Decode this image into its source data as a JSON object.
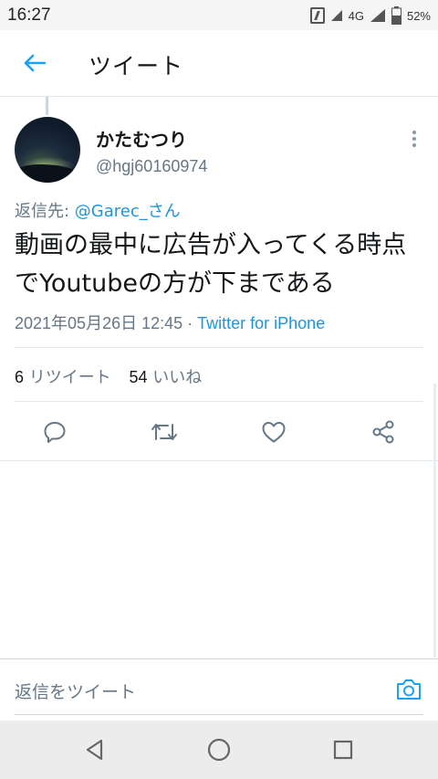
{
  "status_bar": {
    "time": "16:27",
    "network": "4G",
    "battery": "52%"
  },
  "header": {
    "title": "ツイート"
  },
  "tweet": {
    "display_name": "かたむつり",
    "handle": "@hgj60160974",
    "reply_prefix": "返信先: ",
    "reply_to": "@Garec_さん",
    "text": "動画の最中に広告が入ってくる時点でYoutubeの方が下まである",
    "timestamp": "2021年05月26日 12:45",
    "separator": " · ",
    "via": "Twitter for iPhone",
    "retweet_count": "6",
    "retweet_label": " リツイート",
    "like_count": "54",
    "like_label": " いいね"
  },
  "actions": {
    "reply_icon": "reply-icon",
    "retweet_icon": "retweet-icon",
    "like_icon": "heart-icon",
    "share_icon": "share-icon"
  },
  "reply_bar": {
    "placeholder": "返信をツイート"
  },
  "colors": {
    "accent": "#1da1f2",
    "link": "#1b95e0",
    "secondary_text": "#657786",
    "icon_gray": "#657786"
  }
}
